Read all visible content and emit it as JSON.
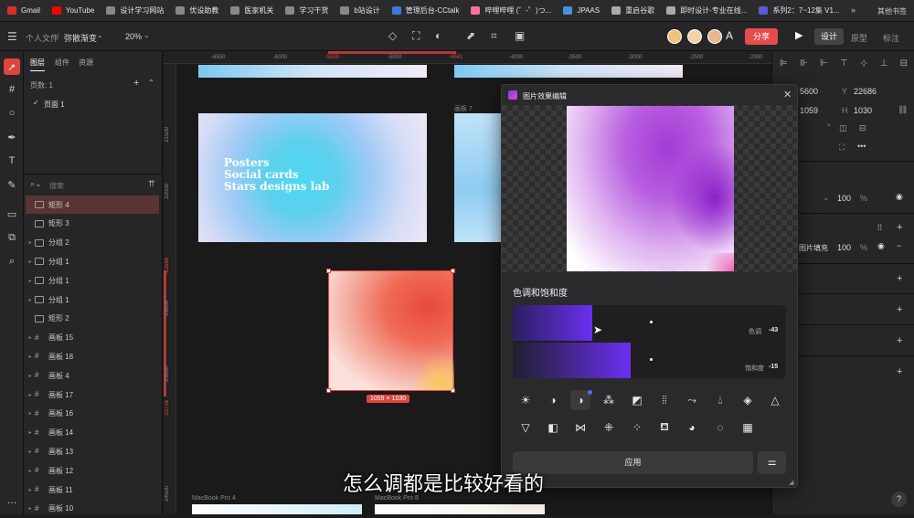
{
  "bookmarks": [
    {
      "label": "Gmail",
      "color": "#d93025"
    },
    {
      "label": "YouTube",
      "color": "#ff0000"
    },
    {
      "label": "设计学习网站",
      "color": "#888"
    },
    {
      "label": "优设助教",
      "color": "#888"
    },
    {
      "label": "医家机关",
      "color": "#888"
    },
    {
      "label": "学习干货",
      "color": "#888"
    },
    {
      "label": "b站设计",
      "color": "#888"
    },
    {
      "label": "管理后台-CCtalk",
      "color": "#3a7bd5"
    },
    {
      "label": "哔哩哔哩 (゜-゜)つ...",
      "color": "#fb7299"
    },
    {
      "label": "JPAAS",
      "color": "#4a8fd8"
    },
    {
      "label": "重启谷歌",
      "color": "#aaa"
    },
    {
      "label": "即时设计-专业在线...",
      "color": "#aaa"
    },
    {
      "label": "系列2：7~12集 V1...",
      "color": "#5b5bd6"
    }
  ],
  "bookmarks_more": "»",
  "bookmarks_other": "其他书签",
  "toolbar": {
    "breadcrumb_root": "个人文件",
    "breadcrumb_file": "弥散渐变",
    "zoom": "20%",
    "share": "分享",
    "tabs": [
      "设计",
      "原型",
      "标注"
    ]
  },
  "left_panel": {
    "tabs": [
      "图层",
      "组件",
      "资源"
    ],
    "pages_label": "页数: 1",
    "page_item": "页面 1",
    "search_placeholder": "搜索",
    "layers": [
      {
        "name": "矩形 4",
        "type": "rect",
        "selected": true
      },
      {
        "name": "矩形 3",
        "type": "rect"
      },
      {
        "name": "分组 2",
        "type": "group"
      },
      {
        "name": "分组 1",
        "type": "group"
      },
      {
        "name": "分组 1",
        "type": "group"
      },
      {
        "name": "分组 1",
        "type": "group"
      },
      {
        "name": "矩形 2",
        "type": "rect"
      },
      {
        "name": "画板 15",
        "type": "board"
      },
      {
        "name": "画板 18",
        "type": "board"
      },
      {
        "name": "画板 4",
        "type": "board"
      },
      {
        "name": "画板 17",
        "type": "board"
      },
      {
        "name": "画板 16",
        "type": "board"
      },
      {
        "name": "画板 14",
        "type": "board"
      },
      {
        "name": "画板 13",
        "type": "board"
      },
      {
        "name": "画板 12",
        "type": "board"
      },
      {
        "name": "画板 11",
        "type": "board"
      },
      {
        "name": "画板 10",
        "type": "board"
      }
    ]
  },
  "ruler": {
    "top": [
      "-6500",
      "-6000",
      "-5600",
      "-5000",
      "-4541",
      "-4000",
      "-3500",
      "-3000",
      "-2500",
      "-2000"
    ],
    "left": [
      "21500",
      "22000",
      "22688",
      "23000",
      "23500",
      "23716",
      "24500"
    ]
  },
  "canvas": {
    "poster_lines": [
      "Posters",
      "Social cards",
      "Stars designs lab"
    ],
    "board7_label": "画板 7",
    "size_badge": "1059 × 1030",
    "mac4": "MacBook Pro 4",
    "mac8": "MacBook Pro 8"
  },
  "right_panel": {
    "x": "5600",
    "y": "22686",
    "w": "1059",
    "h": "1030",
    "opacity": "100",
    "fill_label": "图片填充",
    "fill_opacity": "100",
    "pct": "%"
  },
  "dialog": {
    "title": "图片效果编辑",
    "section": "色调和饱和度",
    "hue_label": "色调",
    "hue_value": "-43",
    "sat_label": "饱和度",
    "sat_value": "-15",
    "apply": "应用"
  },
  "subtitle": "怎么调都是比较好看的",
  "help": "?"
}
